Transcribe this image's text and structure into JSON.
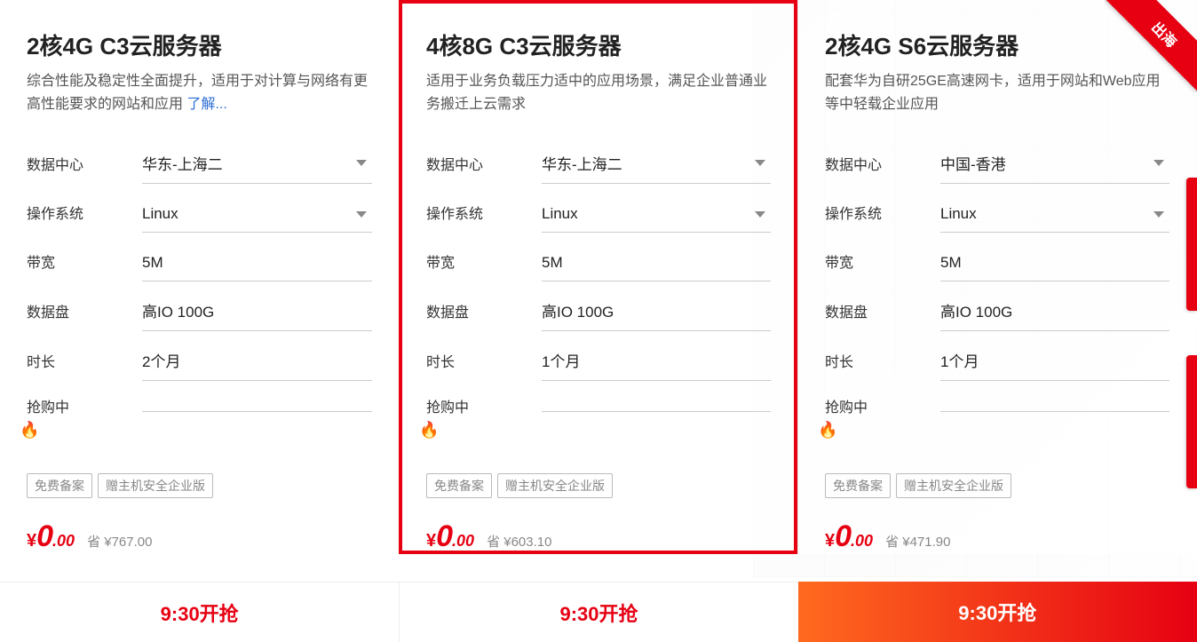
{
  "ribbon": {
    "label": "出海"
  },
  "labels": {
    "datacenter": "数据中心",
    "os": "操作系统",
    "bandwidth": "带宽",
    "disk": "数据盘",
    "duration": "时长",
    "status": "抢购中",
    "learn_more": "了解..."
  },
  "tag_labels": {
    "free_beian": "免费备案",
    "host_security": "赠主机安全企业版"
  },
  "price_labels": {
    "currency": "¥",
    "save_prefix": "省 ¥"
  },
  "cards": [
    {
      "title": "2核4G C3云服务器",
      "desc": "综合性能及稳定性全面提升，适用于对计算与网络有更高性能要求的网站和应用 ",
      "has_learn_more": true,
      "datacenter": "华东-上海二",
      "os": "Linux",
      "bandwidth": "5M",
      "disk": "高IO 100G",
      "duration": "2个月",
      "price_major": "0",
      "price_minor": ".00",
      "save": "767.00",
      "cta": "9:30开抢",
      "cta_style": "red-text",
      "highlight": false
    },
    {
      "title": "4核8G C3云服务器",
      "desc": "适用于业务负载压力适中的应用场景，满足企业普通业务搬迁上云需求",
      "has_learn_more": false,
      "datacenter": "华东-上海二",
      "os": "Linux",
      "bandwidth": "5M",
      "disk": "高IO 100G",
      "duration": "1个月",
      "price_major": "0",
      "price_minor": ".00",
      "save": "603.10",
      "cta": "9:30开抢",
      "cta_style": "red-text",
      "highlight": true
    },
    {
      "title": "2核4G S6云服务器",
      "desc": "配套华为自研25GE高速网卡，适用于网站和Web应用等中轻载企业应用",
      "has_learn_more": false,
      "datacenter": "中国-香港",
      "os": "Linux",
      "bandwidth": "5M",
      "disk": "高IO 100G",
      "duration": "1个月",
      "price_major": "0",
      "price_minor": ".00",
      "save": "471.90",
      "cta": "9:30开抢",
      "cta_style": "red-bg",
      "highlight": false
    }
  ]
}
